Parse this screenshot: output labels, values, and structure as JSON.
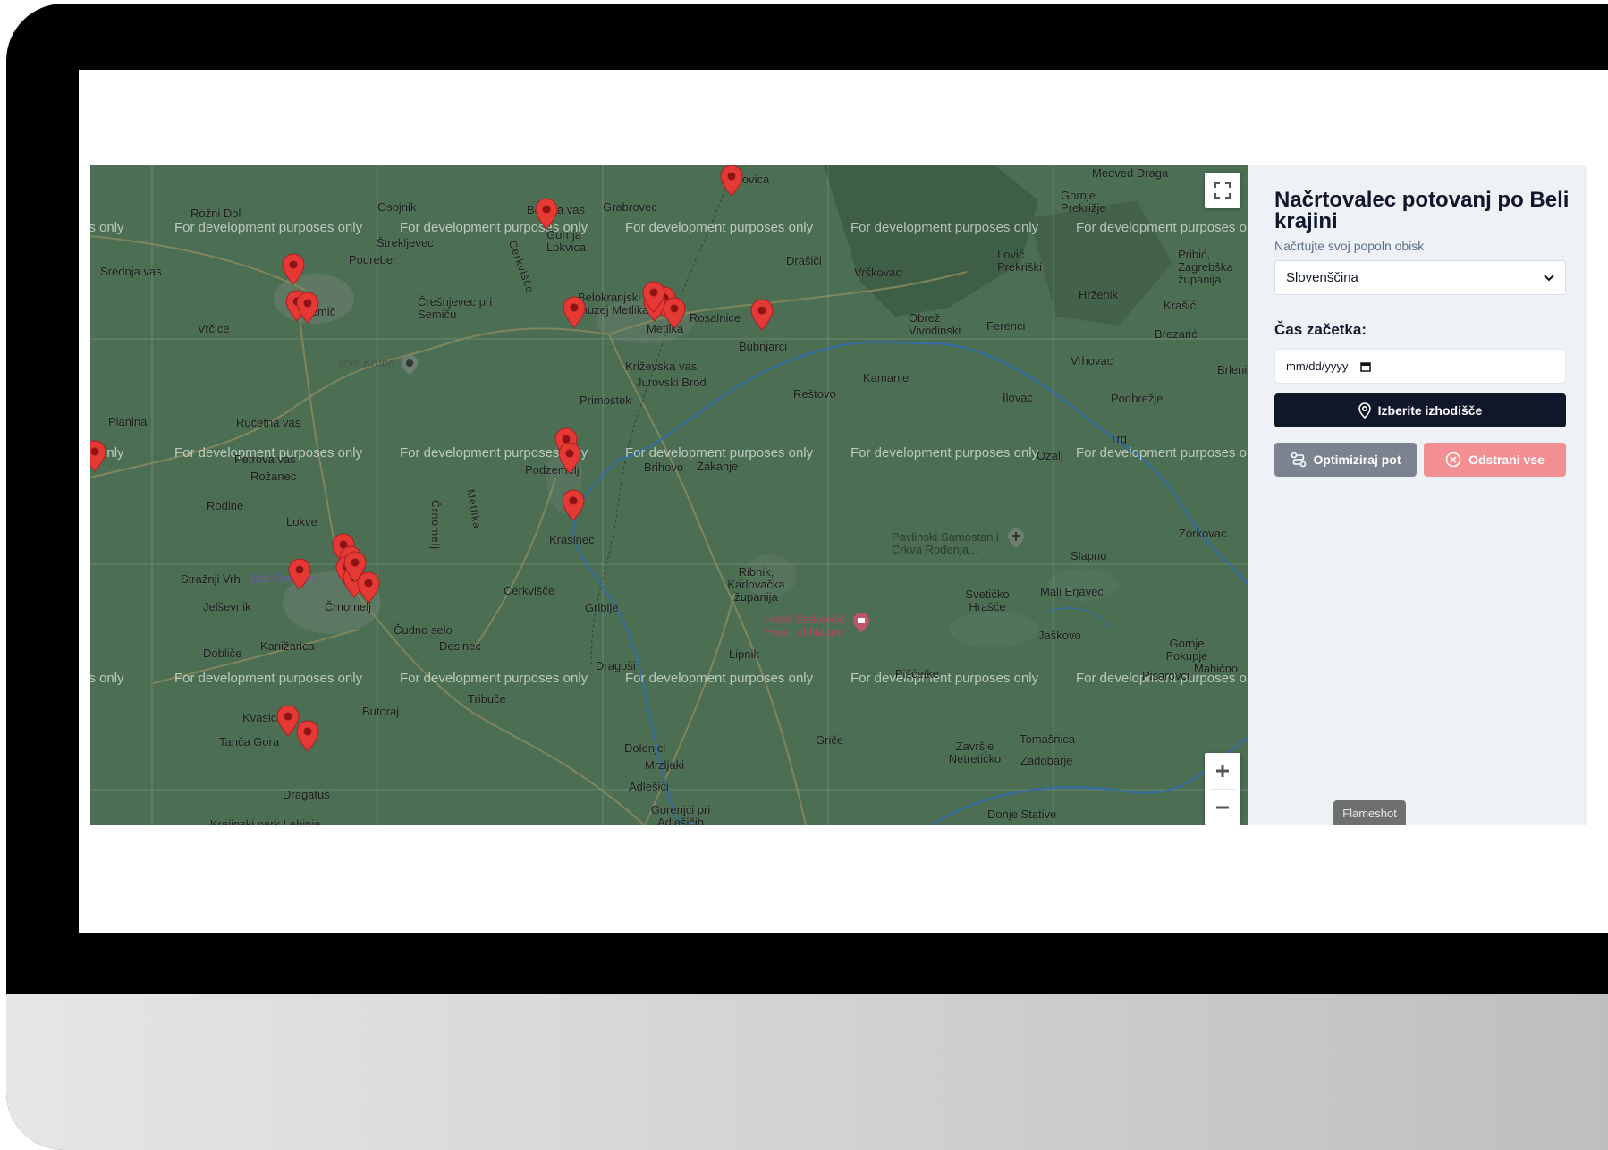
{
  "panel": {
    "title": "Načrtovalec potovanj po Beli krajini",
    "subtitle": "Načrtujte svoj popoln obisk",
    "language_selected": "Slovenščina",
    "start_time_label": "Čas začetka:",
    "date_value": "mm/dd/yyyy",
    "select_start_label": "Izberite izhodišče",
    "optimize_label": "Optimiziraj pot",
    "remove_all_label": "Odstrani vse"
  },
  "map": {
    "watermark": "For development purposes only",
    "places": [
      "Radovica",
      "Medved Draga",
      "Gornje Prekrižje",
      "Rožni Dol",
      "Osojnik",
      "Bereča vas",
      "Grabrovec",
      "Gornja Lokvica",
      "Štrekljevec",
      "Podreber",
      "Srednja vas",
      "Semič",
      "Vrčice",
      "Črešnjevec pri Semiču",
      "Belokranjski muzej Metlika",
      "Metlika",
      "Rosalnice",
      "Drašiči",
      "Vrškovac",
      "Lović Prekriški",
      "Pribić, Zagrebška županija",
      "Hrženik",
      "Krašić",
      "Obrež Vivodinski",
      "Ferenci",
      "Brezarić",
      "Bubnjarci",
      "Križevska vas",
      "Jurovski Brod",
      "Kamanje",
      "Vrhovac",
      "Brleni",
      "Planina",
      "Ručetna vas",
      "Primostek",
      "Reštovo",
      "Ilovac",
      "Podbrežje",
      "Petrova vas",
      "Rožanec",
      "Podzemelj",
      "Brihovo",
      "Žakanje",
      "Ozalj",
      "Trg",
      "Rodine",
      "Lokve",
      "Krasinec",
      "Zorkovac",
      "Slapno",
      "Stražnji Vrh",
      "Jelševnik",
      "Črnomelj",
      "Cerkvišče",
      "Griblje",
      "Ribnik, Karlovačka županija",
      "Svetičko Hrašće",
      "Mali Erjavec",
      "Čudno selo",
      "Desinec",
      "Dobliče",
      "Kanižarica",
      "Lipnik",
      "Jaškovo",
      "Gornje Pokupje",
      "Mahično",
      "Dragoši",
      "Pišćetke",
      "Pisarovci",
      "Tribuče",
      "Butoraj",
      "Kvasica",
      "Tanča Gora",
      "Dolenjci",
      "Mrzljaki",
      "Griče",
      "Tomašnica",
      "Završje Netretićko",
      "Zadobarje",
      "Adlešiči",
      "Gorenjci pri Adlešičih",
      "Dragatuš",
      "Krajinski park Lahinja",
      "Donje Stative",
      "Črnomelj",
      "Metlika",
      "Cerkvišče"
    ],
    "pois": [
      "Izvir Krupe",
      "Lidl Črnomelj",
      "Hotel Srakovčić Heart of Nature",
      "Pavlinski Samostan i Crkva Rođenja..."
    ],
    "pin_count": 24,
    "pin_color": "#e53935",
    "fullscreen_icon": "fullscreen-icon",
    "zoom_in_icon": "plus-icon",
    "zoom_out_icon": "minus-icon"
  },
  "overlay": {
    "tooltip": "Flameshot"
  },
  "colors": {
    "map_bg": "#4c6e53",
    "panel_bg": "#eef2f7",
    "primary": "#0f172a",
    "gray_button": "#7b8390",
    "red_button": "#f38f92"
  }
}
